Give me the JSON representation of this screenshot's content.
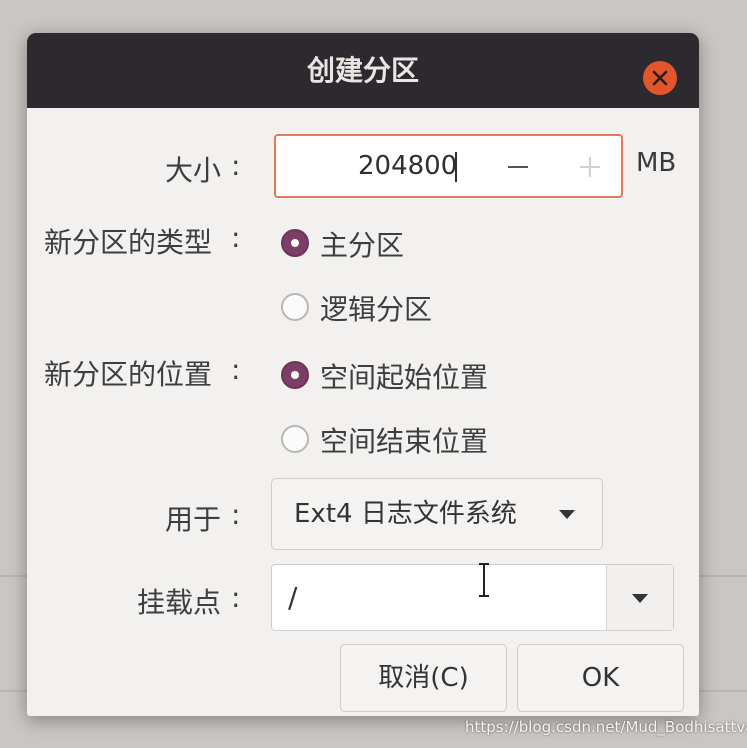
{
  "dialog": {
    "title": "创建分区",
    "close_icon": "close-icon"
  },
  "size": {
    "label": "大小",
    "colon": ":",
    "value": "204800",
    "unit": "MB"
  },
  "type": {
    "label": "新分区的类型",
    "colon": ":",
    "options": [
      {
        "label": "主分区",
        "selected": true
      },
      {
        "label": "逻辑分区",
        "selected": false
      }
    ]
  },
  "location": {
    "label": "新分区的位置",
    "colon": ":",
    "options": [
      {
        "label": "空间起始位置",
        "selected": true
      },
      {
        "label": "空间结束位置",
        "selected": false
      }
    ]
  },
  "use_as": {
    "label": "用于",
    "colon": ":",
    "value": "Ext4 日志文件系统"
  },
  "mount_point": {
    "label": "挂载点",
    "colon": ":",
    "value": "/"
  },
  "buttons": {
    "cancel": "取消(C)",
    "ok": "OK"
  },
  "watermark": "https://blog.csdn.net/Mud_Bodhisattva",
  "colors": {
    "titlebar": "#2c2a2e",
    "close_button": "#e2562b",
    "radio_selected": "#7c3e67",
    "focus_border": "#e07a5a"
  }
}
